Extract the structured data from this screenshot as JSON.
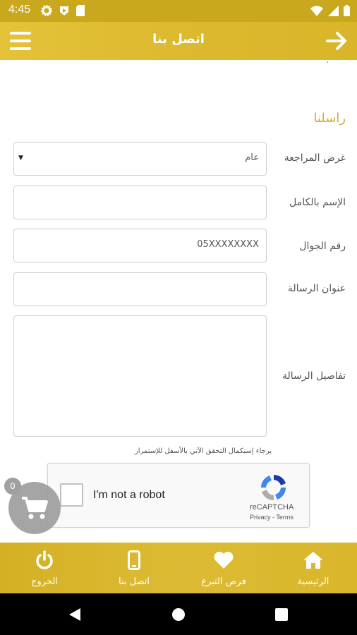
{
  "status_bar": {
    "time": "4:45"
  },
  "app_bar": {
    "title": "اتصل بنا"
  },
  "content": {
    "previous_text": "،",
    "section_title": "راسلنا",
    "form": {
      "purpose_label": "غرض المراجعة",
      "purpose_value": "عام",
      "fullname_label": "الإسم بالكامل",
      "fullname_value": "",
      "mobile_label": "رقم الجوال",
      "mobile_placeholder": "05XXXXXXXX",
      "subject_label": "عنوان الرسالة",
      "subject_value": "",
      "details_label": "تفاصيل الرسالة",
      "details_value": ""
    },
    "hint": "يرجاء إستكمال التحقق الآتي بالأسفل للإستمرار",
    "recaptcha": {
      "label": "I'm not a robot",
      "brand": "reCAPTCHA",
      "links": "Privacy - Terms"
    }
  },
  "cart": {
    "count": "0",
    "icon": "cart-icon"
  },
  "bottom_nav": {
    "items": [
      {
        "label": "الرئيسية",
        "icon": "home-icon"
      },
      {
        "label": "فرص التبرع",
        "icon": "heart-icon"
      },
      {
        "label": "اتصل بنا",
        "icon": "phone-icon"
      },
      {
        "label": "الخروج",
        "icon": "power-icon"
      }
    ]
  },
  "colors": {
    "accent": "#d6ad2e",
    "bar": "#dcb92e",
    "fab": "#9e9e9e"
  }
}
